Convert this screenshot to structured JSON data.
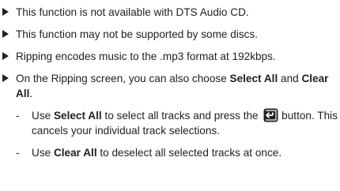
{
  "notes": {
    "items": [
      {
        "text": "This function is not available with DTS Audio CD."
      },
      {
        "text": "This function may not be supported by some discs."
      },
      {
        "text": "Ripping encodes music to the .mp3 format at 192kbps."
      },
      {
        "pre": "On the Ripping screen, you can also choose ",
        "bold1": "Select All",
        "mid": " and ",
        "bold2": "Clear All",
        "post": "."
      }
    ],
    "sub_items": [
      {
        "dash": "-",
        "pre": "Use ",
        "bold": "Select All",
        "mid": " to select all tracks and press the ",
        "post": " button. This cancels your individual track selections.",
        "icon": "enter-button-icon"
      },
      {
        "dash": "-",
        "pre": "Use ",
        "bold": "Clear All",
        "post": " to deselect all selected tracks at once."
      }
    ]
  }
}
